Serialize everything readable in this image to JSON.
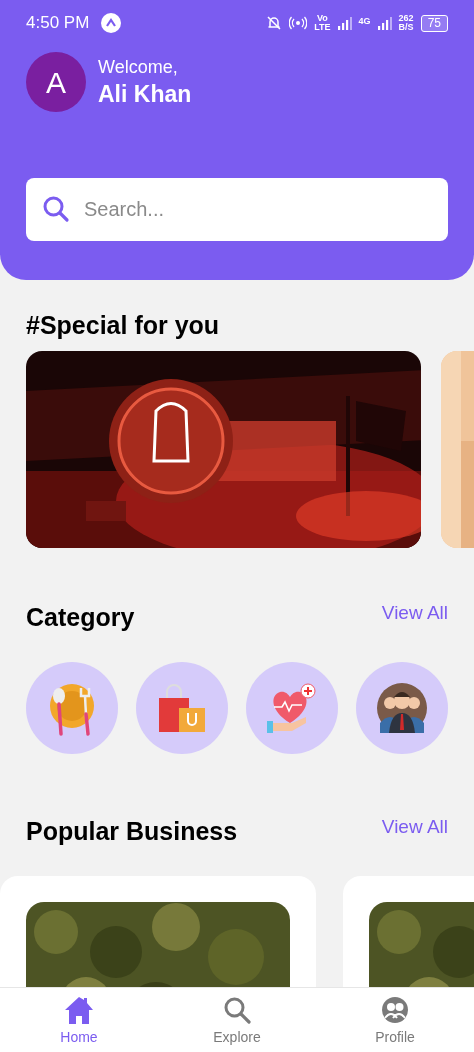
{
  "status_bar": {
    "time": "4:50 PM",
    "volte_top": "Vo",
    "volte_bottom": "LTE",
    "network": "4G",
    "speed": "262",
    "speed_unit": "B/S",
    "battery": "75"
  },
  "header": {
    "avatar_letter": "A",
    "greeting": "Welcome,",
    "user_name": "Ali Khan"
  },
  "search": {
    "placeholder": "Search..."
  },
  "special": {
    "title": "#Special for you",
    "banners": [
      {
        "kind": "concert"
      },
      {
        "kind": "peek"
      }
    ]
  },
  "category": {
    "title": "Category",
    "view_all": "View All",
    "items": [
      {
        "kind": "food"
      },
      {
        "kind": "shopping"
      },
      {
        "kind": "health"
      },
      {
        "kind": "people"
      }
    ]
  },
  "popular": {
    "title": "Popular Business",
    "view_all": "View All"
  },
  "nav": [
    {
      "label": "Home",
      "kind": "home",
      "selected": true
    },
    {
      "label": "Explore",
      "kind": "search",
      "selected": false
    },
    {
      "label": "Profile",
      "kind": "profile",
      "selected": false
    }
  ]
}
